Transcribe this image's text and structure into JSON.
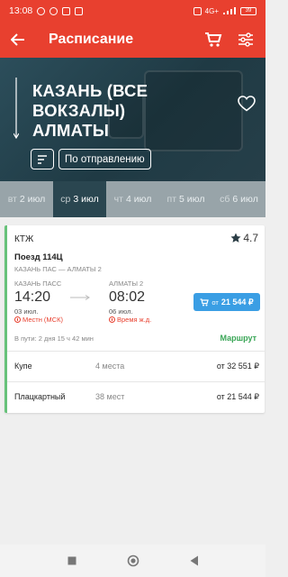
{
  "status_bar": {
    "time": "13:08",
    "signal_label": "4G+",
    "battery": "39"
  },
  "app_bar": {
    "title": "Расписание"
  },
  "route": {
    "from_line1": "КАЗАНЬ (ВСЕ",
    "from_line2": "ВОКЗАЛЫ)",
    "to": "АЛМАТЫ",
    "filter_label": "По отправлению"
  },
  "dates": [
    {
      "weekday": "вт",
      "date": "2 июл"
    },
    {
      "weekday": "ср",
      "date": "3 июл"
    },
    {
      "weekday": "чт",
      "date": "4 июл"
    },
    {
      "weekday": "пт",
      "date": "5 июл"
    },
    {
      "weekday": "сб",
      "date": "6 июл"
    }
  ],
  "selected_date_index": 1,
  "train_card": {
    "carrier": "КТЖ",
    "rating": "4.7",
    "train": "Поезд 114Ц",
    "route": "КАЗАНЬ ПАС — АЛМАТЫ 2",
    "departure": {
      "station": "КАЗАНЬ ПАСС",
      "time": "14:20",
      "date": "03 июл.",
      "tz": "Местн (МСК)"
    },
    "arrival": {
      "station": "АЛМАТЫ 2",
      "time": "08:02",
      "date": "06 июл.",
      "tz": "Время ж.д."
    },
    "price_from": "от",
    "price": "21 544 ₽",
    "duration": "В пути: 2 дня 15 ч 42 мин",
    "route_link": "Маршрут",
    "classes": [
      {
        "name": "Купе",
        "seats": "4 места",
        "price": "от 32 551 ₽"
      },
      {
        "name": "Плацкартный",
        "seats": "38 мест",
        "price": "от 21 544 ₽"
      }
    ]
  },
  "icons": {
    "back": "arrow-left-icon",
    "cart": "cart-icon",
    "settings": "sliders-icon",
    "favorite": "heart-outline-icon",
    "sort": "sort-lines-icon",
    "star": "star-icon"
  },
  "colors": {
    "primary": "#e8402f",
    "hero": "#2a4650",
    "price_button": "#3a9ee4",
    "accent_green": "#3aa657"
  }
}
